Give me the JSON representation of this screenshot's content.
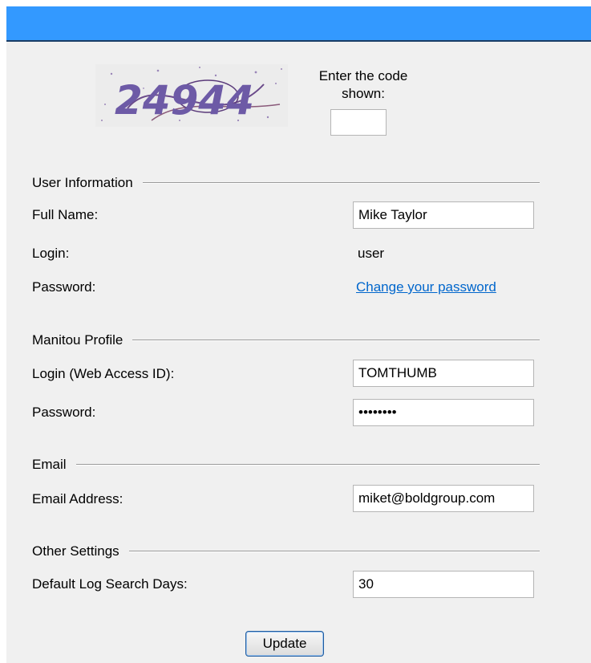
{
  "captcha": {
    "image_text": "24944",
    "prompt": "Enter the code shown:",
    "input_value": ""
  },
  "sections": {
    "user_info": "User Information",
    "manitou": "Manitou Profile",
    "email": "Email",
    "other": "Other Settings"
  },
  "user": {
    "full_name_label": "Full Name:",
    "full_name_value": "Mike Taylor",
    "login_label": "Login:",
    "login_value": "user",
    "password_label": "Password:",
    "password_link": "Change your password"
  },
  "manitou": {
    "login_label": "Login (Web Access ID):",
    "login_value": "TOMTHUMB",
    "password_label": "Password:",
    "password_value": "********"
  },
  "email": {
    "label": "Email Address:",
    "value": "miket@boldgroup.com"
  },
  "other": {
    "days_label": "Default Log Search Days:",
    "days_value": "30"
  },
  "actions": {
    "update_label": "Update"
  },
  "colors": {
    "titlebar": "#3399ff",
    "panel": "#f0f0f0",
    "link": "#0066cc"
  }
}
